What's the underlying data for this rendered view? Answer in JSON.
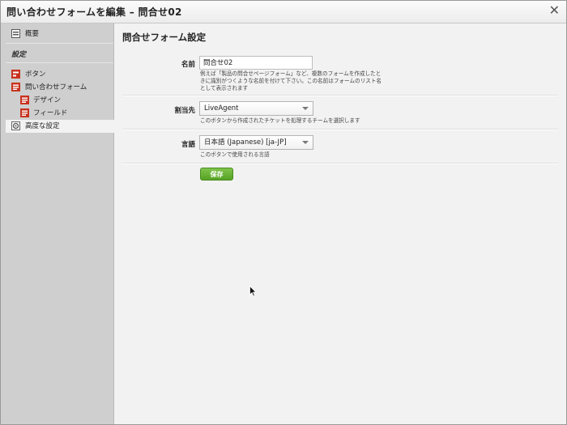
{
  "window": {
    "title": "問い合わせフォームを編集 – 問合せ02",
    "close": "✕"
  },
  "sidebar": {
    "overview": "概要",
    "section_settings": "設定",
    "items": [
      {
        "label": "ボタン",
        "icon": "button-icon"
      },
      {
        "label": "問い合わせフォーム",
        "icon": "form-icon"
      },
      {
        "label": "デザイン",
        "icon": "design-icon"
      },
      {
        "label": "フィールド",
        "icon": "field-icon"
      },
      {
        "label": "高度な設定",
        "icon": "gear-icon"
      }
    ]
  },
  "main": {
    "heading": "問合せフォーム設定",
    "name": {
      "label": "名前",
      "value": "問合せ02",
      "help": "例えば「製品の問合せページフォーム」など、複数のフォームを作成したときに識別がつくような名前を付けて下さい。この名前はフォームのリスト名として表示されます"
    },
    "assign": {
      "label": "割当先",
      "value": "LiveAgent",
      "help": "このボタンから作成されたチケットを処理するチームを選択します"
    },
    "language": {
      "label": "言語",
      "value": "日本語 (Japanese) [ja-JP]",
      "help": "このボタンで使用される言語"
    },
    "save_label": "保存"
  },
  "colors": {
    "accent_green": "#5eaa2c",
    "icon_red": "#c8321e",
    "sidebar_bg": "#cfcfcf"
  }
}
